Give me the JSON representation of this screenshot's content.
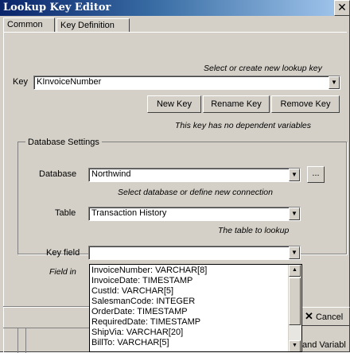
{
  "window": {
    "title": "Lookup Key Editor",
    "close_glyph": "✕"
  },
  "tabs": [
    {
      "label": "Common"
    },
    {
      "label": "Key Definition"
    }
  ],
  "key_section": {
    "hint": "Select or create new lookup key",
    "key_label": "Key",
    "key_value": "KInvoiceNumber",
    "new_key_label": "New Key",
    "rename_key_label": "Rename Key",
    "remove_key_label": "Remove Key",
    "dependent_hint": "This key has no dependent variables"
  },
  "database_settings": {
    "group_label": "Database Settings",
    "database_label": "Database",
    "database_value": "Northwind",
    "browse_label": "...",
    "database_hint": "Select database or define new connection",
    "table_label": "Table",
    "table_value": "Transaction History",
    "table_hint": "The table to lookup",
    "keyfield_label": "Key field",
    "keyfield_value": "",
    "keyfield_hint_partial": "Field in"
  },
  "keyfield_dropdown": {
    "options": [
      "InvoiceNumber: VARCHAR[8]",
      "InvoiceDate: TIMESTAMP",
      "CustId: VARCHAR[5]",
      "SalesmanCode: INTEGER",
      "OrderDate: TIMESTAMP",
      "RequiredDate: TIMESTAMP",
      "ShipVia: VARCHAR[20]",
      "BillTo: VARCHAR[5]"
    ]
  },
  "footer": {
    "cancel_label": "Cancel",
    "and_variables_label": "and Variabl"
  },
  "colors": {
    "titlebar_start": "#0a246a",
    "titlebar_end": "#a6caf0",
    "face": "#d4d0c8"
  }
}
